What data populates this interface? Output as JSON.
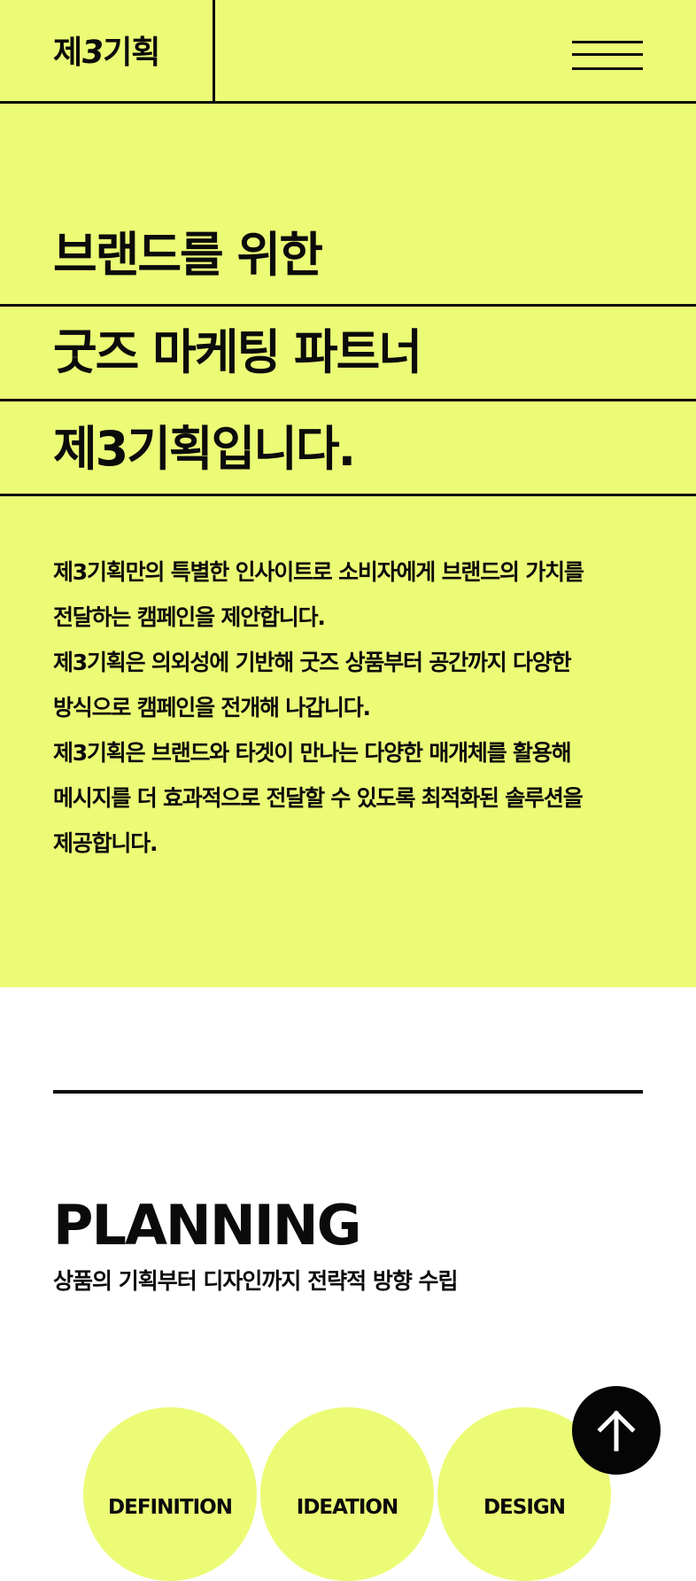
{
  "header": {
    "logo_prefix": "제",
    "logo_three": "3",
    "logo_suffix": "기획",
    "menu_icon": "hamburger-menu-icon"
  },
  "hero": {
    "headline": [
      "브랜드를 위한",
      "굿즈 마케팅 파트너",
      "제3기획입니다."
    ],
    "description": [
      "제3기획만의 특별한 인사이트로 소비자에게 브랜드의 가치를",
      "전달하는 캠페인을 제안합니다.",
      "제3기획은 의외성에 기반해 굿즈 상품부터 공간까지 다양한",
      "방식으로 캠페인을 전개해 나갑니다.",
      "제3기획은 브랜드와 타겟이 만나는 다양한 매개체를 활용해",
      "메시지를 더 효과적으로 전달할 수 있도록 최적화된 솔루션을",
      "제공합니다."
    ]
  },
  "planning": {
    "title": "PLANNING",
    "subtitle": "상품의 기획부터 디자인까지 전략적 방향 수립",
    "steps": [
      "DEFINITION",
      "IDEATION",
      "DESIGN"
    ]
  },
  "scroll_top": {
    "icon": "arrow-up-icon"
  },
  "colors": {
    "accent": "#ecfb76",
    "ink": "#0b0b0b",
    "background": "#ffffff"
  }
}
